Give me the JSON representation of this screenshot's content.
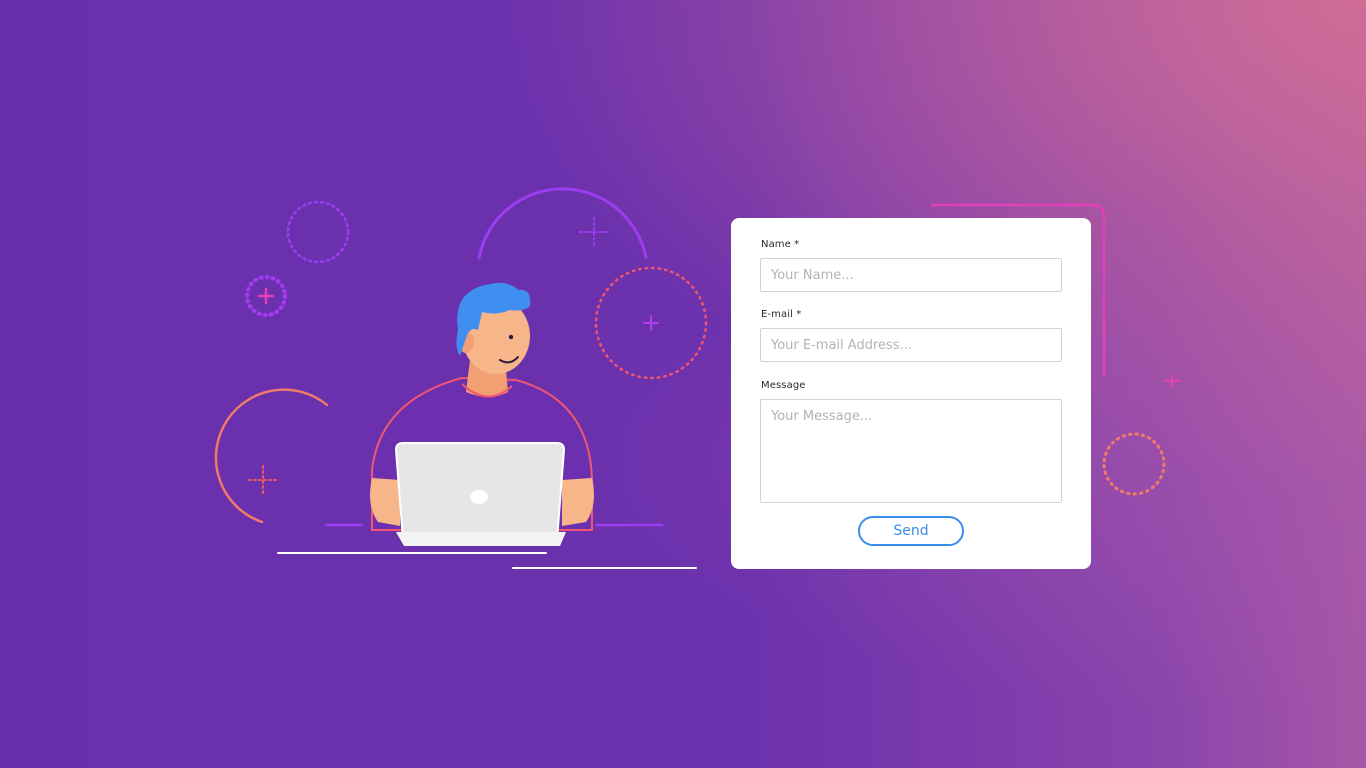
{
  "form": {
    "name_label": "Name *",
    "name_placeholder": "Your Name...",
    "email_label": "E-mail *",
    "email_placeholder": "Your E-mail Address...",
    "message_label": "Message",
    "message_placeholder": "Your Message...",
    "send_label": "Send"
  },
  "colors": {
    "accent": "#3a8ee8",
    "background_primary": "#6930ad",
    "background_corner": "#d26e96",
    "decor_purple": "#9b3df0",
    "decor_coral": "#f07a6a",
    "decor_pink": "#e23fb9",
    "hair": "#3f8ef0",
    "shirt": "#6b2fb0",
    "skin": "#f7b68a",
    "laptop": "#e6e6e6"
  },
  "icons": [
    "person-with-laptop-illustration",
    "dotted-circle-icon",
    "plus-icon",
    "sparkle-icon"
  ]
}
